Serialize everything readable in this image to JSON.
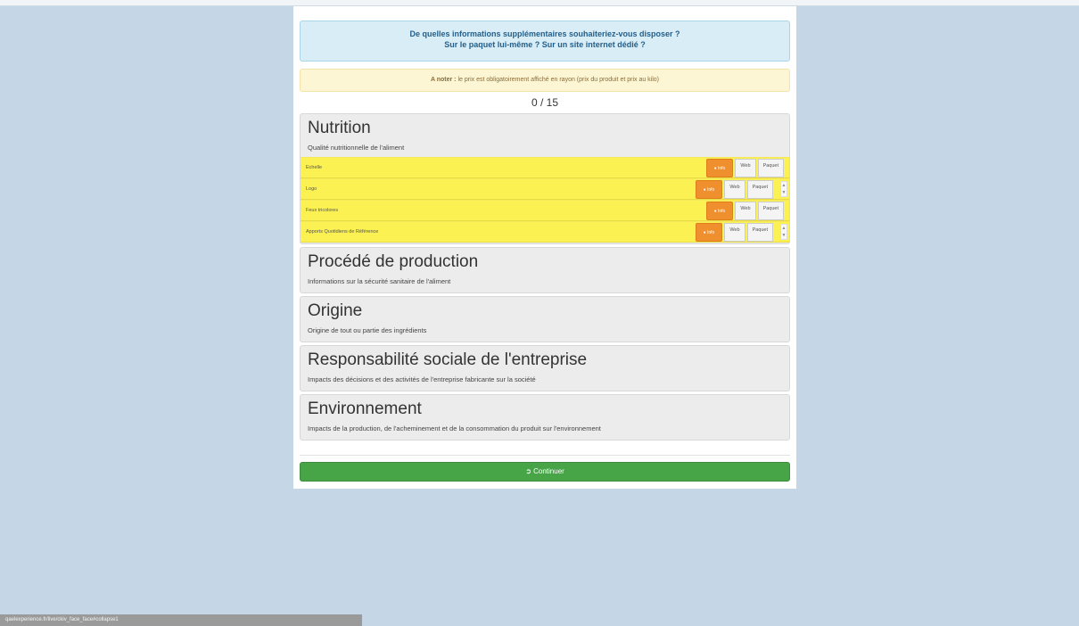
{
  "question": {
    "line1": "De quelles informations supplémentaires souhaiteriez-vous disposer ?",
    "line2": "Sur le paquet lui-même ? Sur un site internet dédié ?"
  },
  "note": {
    "label": "A noter :",
    "text": "le prix est obligatoirement affiché en rayon (prix du produit et prix au kilo)"
  },
  "counter": "0 / 15",
  "sections": [
    {
      "title": "Nutrition",
      "subtitle": "Qualité nutritionnelle de l'aliment",
      "items": [
        {
          "label": "Echelle",
          "info": "Info",
          "web": "Web",
          "paquet": "Paquet"
        },
        {
          "label": "Logo",
          "info": "Info",
          "web": "Web",
          "paquet": "Paquet"
        },
        {
          "label": "Feux tricolores",
          "info": "Info",
          "web": "Web",
          "paquet": "Paquet"
        },
        {
          "label": "Apports Quotidiens de Référence",
          "info": "Info",
          "web": "Web",
          "paquet": "Paquet"
        }
      ]
    },
    {
      "title": "Procédé de production",
      "subtitle": "Informations sur la sécurité sanitaire de l'aliment"
    },
    {
      "title": "Origine",
      "subtitle": "Origine de tout ou partie des ingrédients"
    },
    {
      "title": "Responsabilité sociale de l'entreprise",
      "subtitle": "Impacts des décisions et des activités de l'entreprise fabricante sur la société"
    },
    {
      "title": "Environnement",
      "subtitle": "Impacts de la production, de l'acheminement et de la consommation du produit sur l'environnement"
    }
  ],
  "continue_label": "Continuer",
  "status_url": "qaelexperience.fr/live/ckiv_face_face#collapse1",
  "colors": {
    "background": "#c5d6e6",
    "info_alert": "#d9edf7",
    "warning_alert": "#fcf6d4",
    "highlight": "#fbf152",
    "info_button": "#ef8f2e",
    "continue_button": "#47a447"
  },
  "icons": {
    "info": "info-circle-icon",
    "continue": "arrow-circle-icon"
  }
}
